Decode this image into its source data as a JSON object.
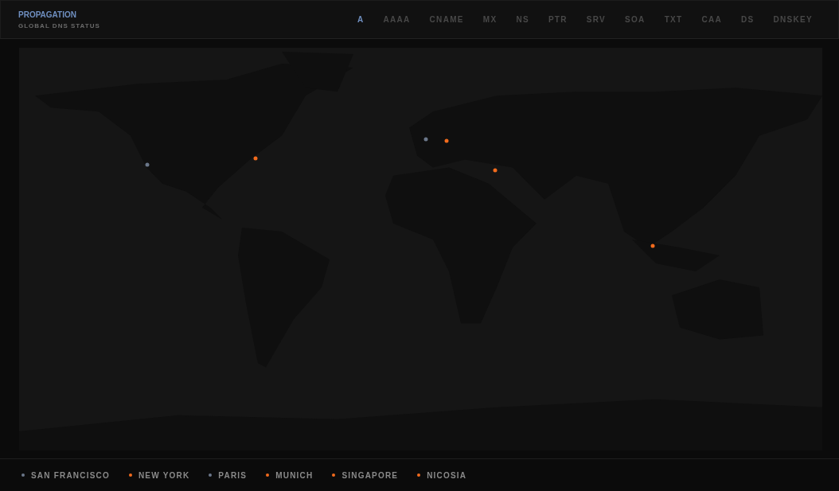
{
  "header": {
    "title": "PROPAGATION",
    "subtitle": "GLOBAL DNS STATUS"
  },
  "record_tabs": [
    {
      "label": "A",
      "selected": true
    },
    {
      "label": "AAAA",
      "selected": false
    },
    {
      "label": "CNAME",
      "selected": false
    },
    {
      "label": "MX",
      "selected": false
    },
    {
      "label": "NS",
      "selected": false
    },
    {
      "label": "PTR",
      "selected": false
    },
    {
      "label": "SRV",
      "selected": false
    },
    {
      "label": "SOA",
      "selected": false
    },
    {
      "label": "TXT",
      "selected": false
    },
    {
      "label": "CAA",
      "selected": false
    },
    {
      "label": "DS",
      "selected": false
    },
    {
      "label": "DNSKEY",
      "selected": false
    }
  ],
  "locations": [
    {
      "name": "SAN FRANCISCO",
      "color": "#6b778a"
    },
    {
      "name": "NEW YORK",
      "color": "#f26b1d"
    },
    {
      "name": "PARIS",
      "color": "#6b778a"
    },
    {
      "name": "MUNICH",
      "color": "#f26b1d"
    },
    {
      "name": "SINGAPORE",
      "color": "#f26b1d"
    },
    {
      "name": "NICOSIA",
      "color": "#f26b1d"
    }
  ]
}
